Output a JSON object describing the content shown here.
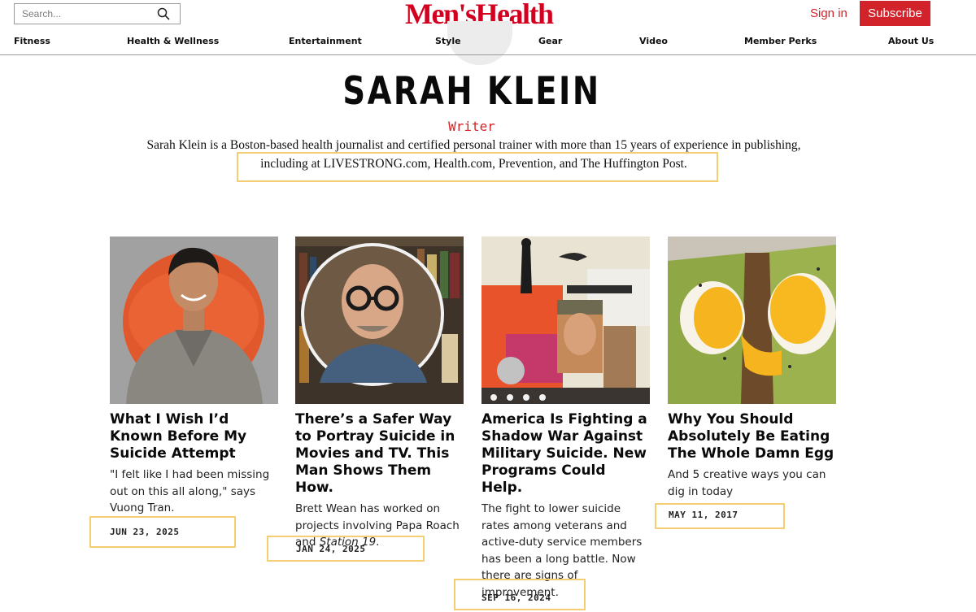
{
  "header": {
    "search": {
      "placeholder": "Search...",
      "icon": "search-icon"
    },
    "logo": "Men'sHealth",
    "sign_in": "Sign in",
    "subscribe": "Subscribe",
    "nav": [
      "Fitness",
      "Health & Wellness",
      "Entertainment",
      "Style",
      "Gear",
      "Video",
      "Member Perks",
      "About Us"
    ]
  },
  "author": {
    "name": "SARAH KLEIN",
    "role": "Writer",
    "bio_line1": "Sarah Klein is a Boston-based health journalist and certified personal trainer with more than 15 years of experience in publishing,",
    "bio_line2": "including at LIVESTRONG.com, Health.com, Prevention, and The Huffington Post."
  },
  "articles": [
    {
      "title": "What I Wish I’d Known Before My Suicide Attempt",
      "description": "\"I felt like I had been missing out on this all along,\" says Vuong Tran.",
      "date": "JUN 23, 2025"
    },
    {
      "title": "There’s a Safer Way to Portray Suicide in Movies and TV. This Man Shows Them How.",
      "description_prefix": "Brett Wean has worked on projects involving Papa Roach and ",
      "description_italic": "Station 19",
      "description_suffix": ".",
      "date": "JAN 24, 2025"
    },
    {
      "title": "America Is Fighting a Shadow War Against Military Suicide. New Programs Could Help.",
      "description": "The fight to lower suicide rates among veterans and active-duty service members has been a long battle. Now there are signs of improvement.",
      "date": "SEP 16, 2024"
    },
    {
      "title": "Why You Should Absolutely Be Eating The Whole Damn Egg",
      "description": "And 5 creative ways you can dig in today",
      "date": "MAY 11, 2017"
    }
  ],
  "colors": {
    "brand_red": "#d2232a",
    "highlight": "#f5cd72"
  }
}
